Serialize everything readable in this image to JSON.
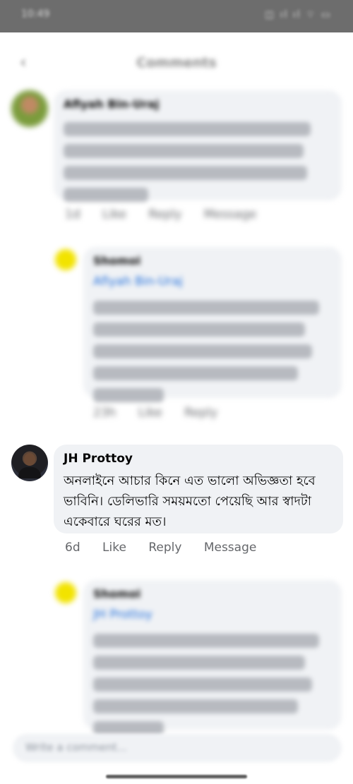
{
  "status_bar": {
    "time": "10:49",
    "indicators": "◫ ıl ıl ⌔ ▭"
  },
  "header": {
    "title": "Comments",
    "back_icon": "chevron-left-icon"
  },
  "comments": [
    {
      "author": "Afiyah Bin-Uraj",
      "text": "",
      "time": "1d",
      "blurred": true
    },
    {
      "author": "Shomoi",
      "mention": "Afiyah Bin-Uraj",
      "text": "",
      "time": "23h",
      "blurred": true,
      "reply": true
    },
    {
      "author": "JH Prottoy",
      "text": "অনলাইনে আচার কিনে এত ভালো অভিজ্ঞতা হবে ভাবিনি। ডেলিভারি সময়মতো পেয়েছি আর স্বাদটা একেবারে ঘরের মত।",
      "time": "6d",
      "actions": [
        "Like",
        "Reply",
        "Message"
      ],
      "blurred": false
    },
    {
      "author": "Shomoi",
      "mention": "JH Prottoy",
      "text": "",
      "blurred": true,
      "reply": true
    }
  ],
  "blurred_actions": [
    "Like",
    "Reply",
    "Message"
  ],
  "composer": {
    "placeholder": "Write a comment..."
  }
}
